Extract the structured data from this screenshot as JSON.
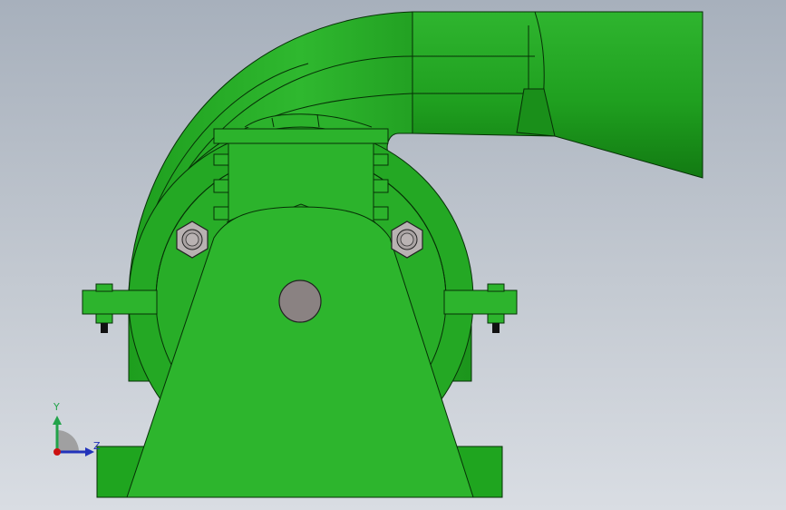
{
  "viewport": {
    "background_top": "#a7b0bc",
    "background_bottom": "#d9dde3"
  },
  "model": {
    "part_color": "#22aa22",
    "part_color_light": "#33bb33",
    "part_color_dark": "#116611",
    "edge_color": "#003300",
    "shaft_color": "#8a8282",
    "bolt_color": "#b0aaaa",
    "nut_color": "#1a1a1a"
  },
  "triad": {
    "y_label": "Y",
    "z_label": "Z",
    "y_color": "#22a34a",
    "z_color": "#2233bb",
    "origin_color": "#cc1111"
  }
}
